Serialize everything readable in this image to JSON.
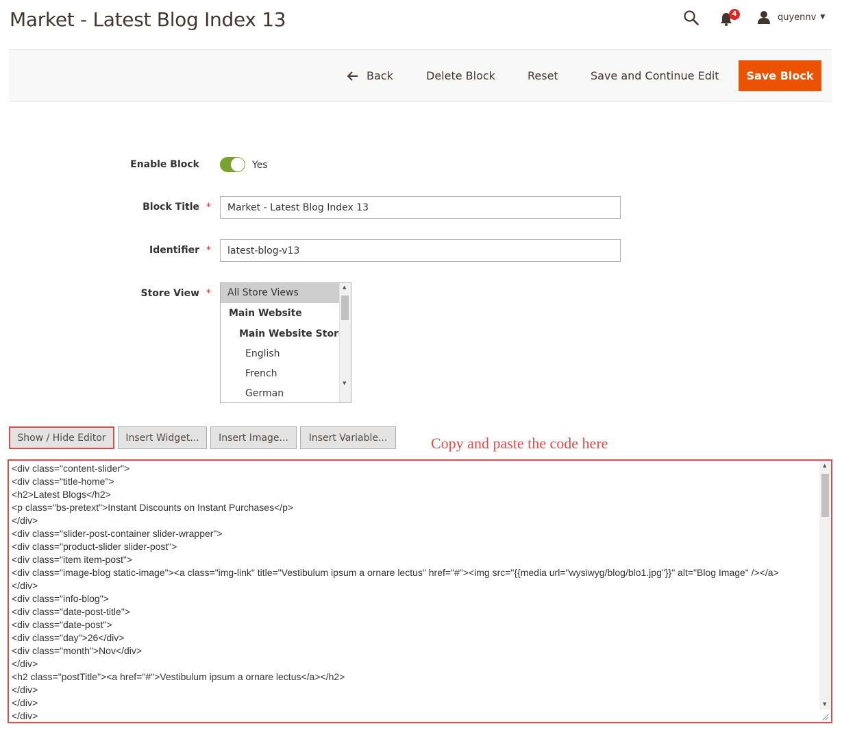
{
  "header": {
    "title": "Market - Latest Blog Index 13",
    "notifications_count": "4",
    "user_name": "quyennv"
  },
  "actions": {
    "back": "Back",
    "delete": "Delete Block",
    "reset": "Reset",
    "save_continue": "Save and Continue Edit",
    "save": "Save Block"
  },
  "form": {
    "enable_label": "Enable Block",
    "enable_value": "Yes",
    "title_label": "Block Title",
    "title_value": "Market - Latest Blog Index 13",
    "identifier_label": "Identifier",
    "identifier_value": "latest-blog-v13",
    "store_label": "Store View",
    "store_options": [
      "All Store Views",
      "Main Website",
      "Main Website Store",
      "English",
      "French",
      "German"
    ]
  },
  "editor": {
    "show_hide": "Show / Hide Editor",
    "insert_widget": "Insert Widget...",
    "insert_image": "Insert Image...",
    "insert_variable": "Insert Variable...",
    "annotation": "Copy and paste the code here",
    "lines": [
      "<div class=\"content-slider\">",
      "<div class=\"title-home\">",
      "<h2>Latest Blogs</h2>",
      "<p class=\"bs-pretext\">Instant Discounts on Instant Purchases</p>",
      "</div>",
      "<div class=\"slider-post-container slider-wrapper\">",
      "<div class=\"product-slider slider-post\">",
      "<div class=\"item item-post\">",
      "<div class=\"image-blog static-image\"><a class=\"img-link\" title=\"Vestibulum ipsum a ornare lectus\" href=\"#\"><img src=\"{{media url=\"wysiwyg/blog/blo1.jpg\"}}\" alt=\"Blog Image\" /></a>",
      "</div>",
      "<div class=\"info-blog\">",
      "<div class=\"date-post-title\">",
      "<div class=\"date-post\">",
      "<div class=\"day\">26</div>",
      "<div class=\"month\">Nov</div>",
      "</div>",
      "<h2 class=\"postTitle\"><a href=\"#\">Vestibulum ipsum a ornare lectus</a></h2>",
      "</div>",
      "</div>",
      "</div>"
    ]
  },
  "colors": {
    "accent": "#eb5202",
    "toggle_on": "#79a22e",
    "annotation": "#e04a4a",
    "badge": "#e22626"
  }
}
